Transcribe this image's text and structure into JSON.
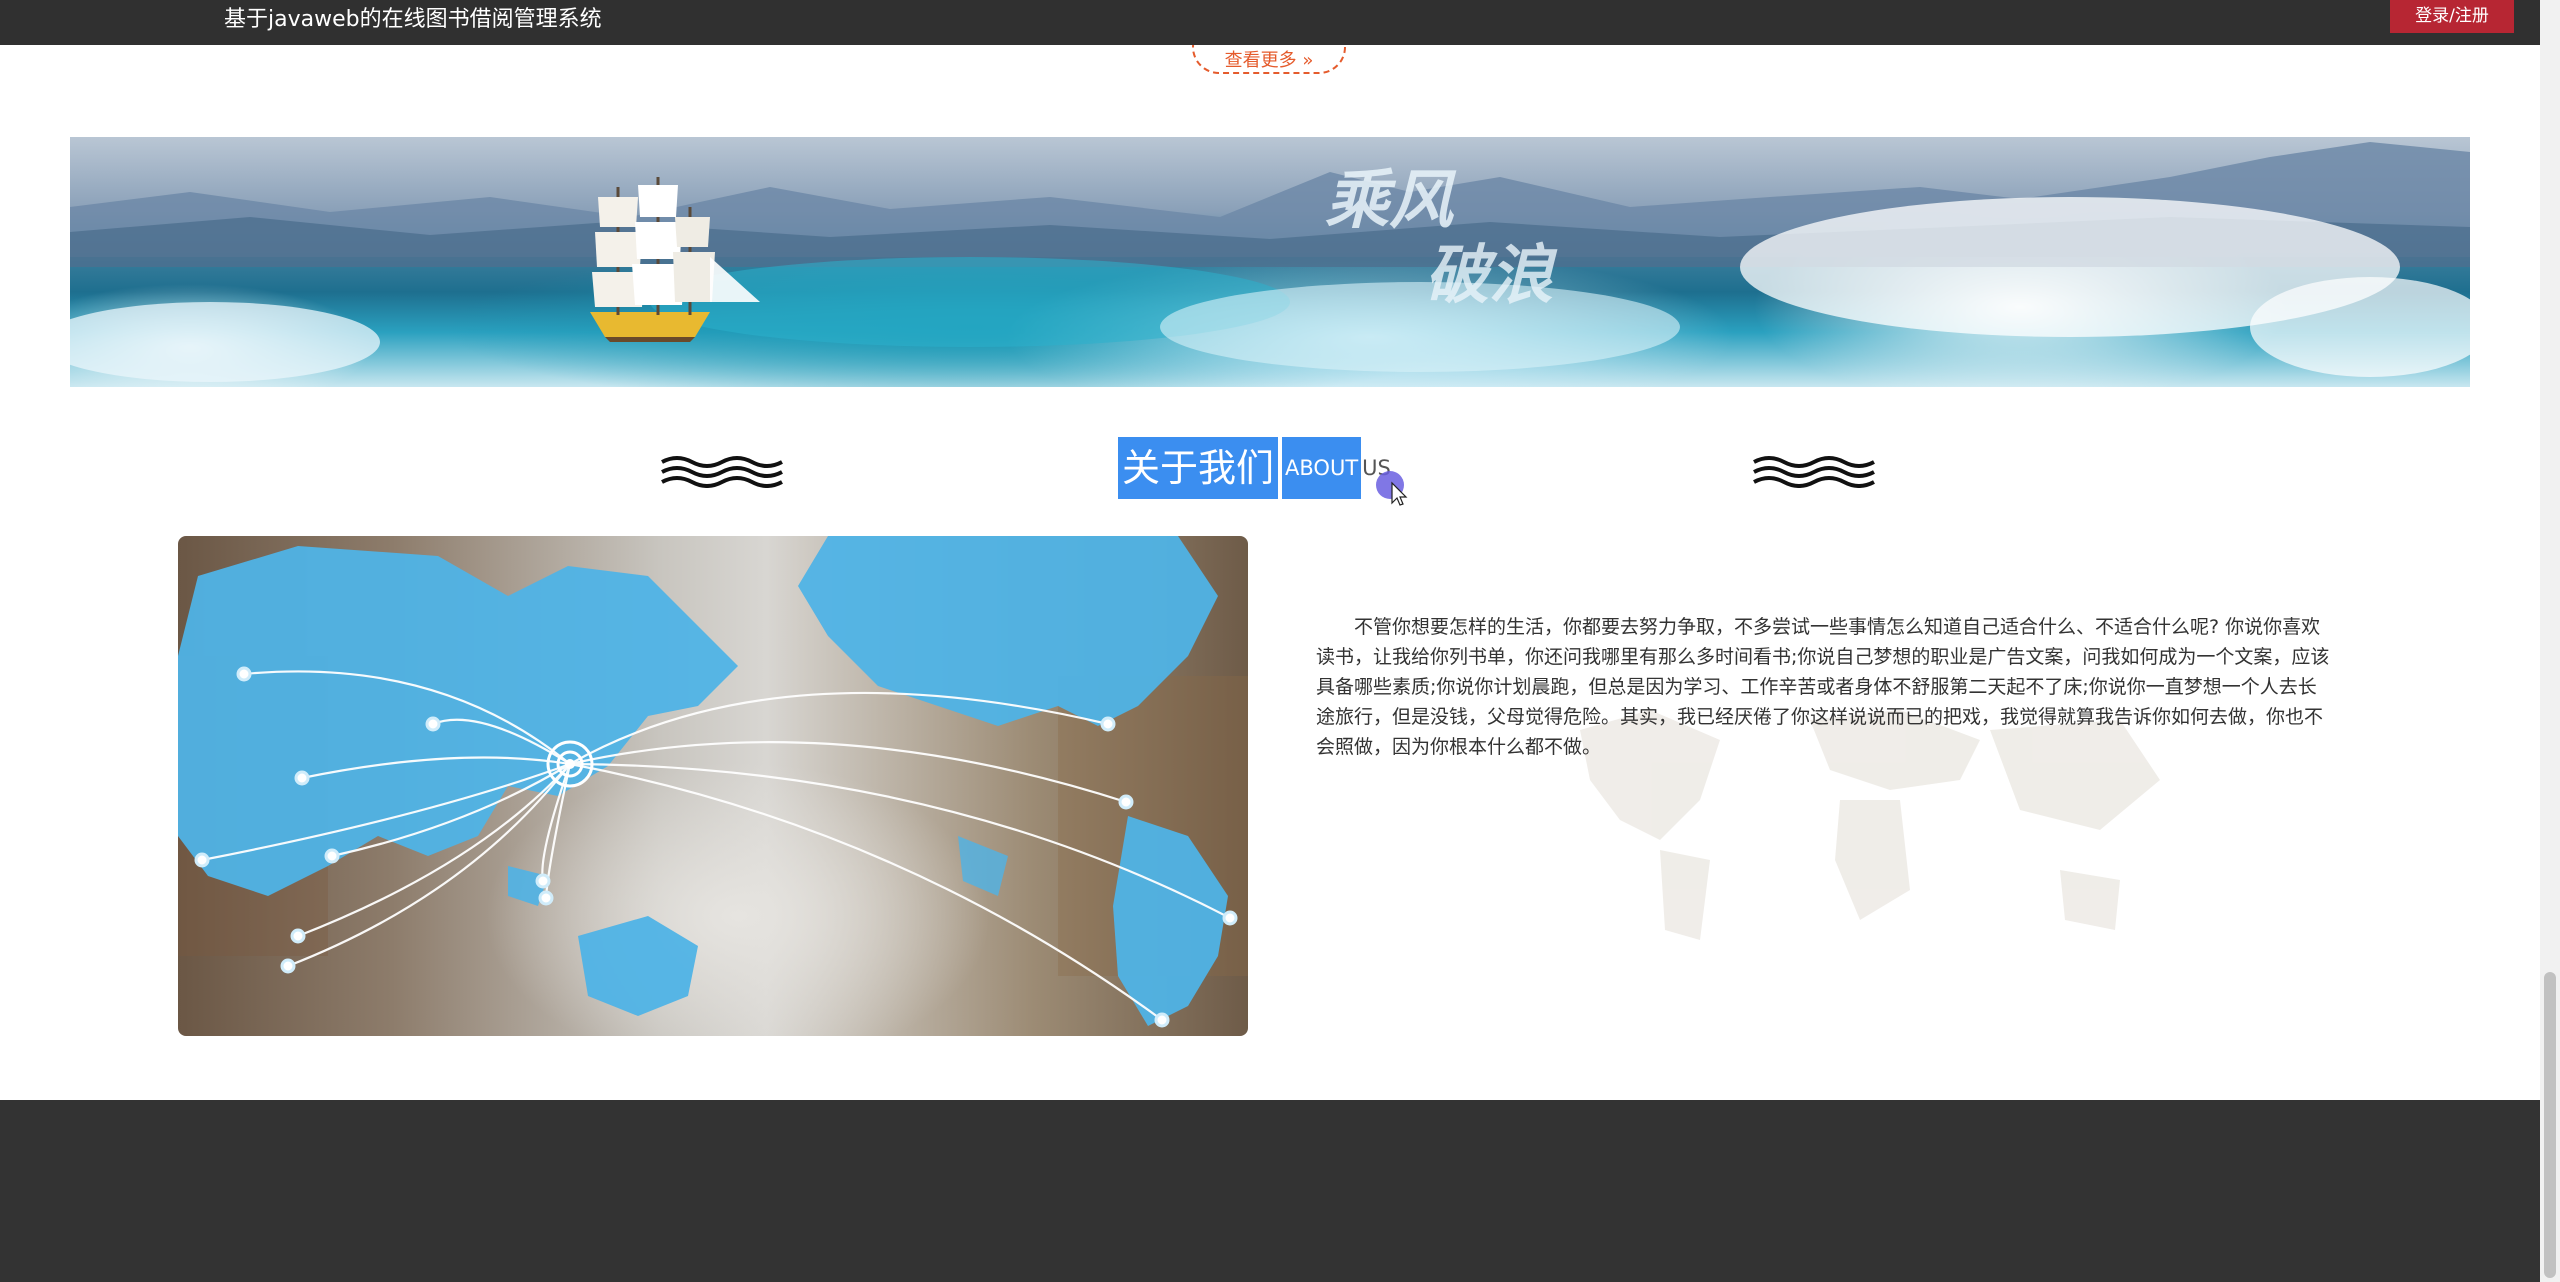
{
  "header": {
    "site_title": "基于javaweb的在线图书借阅管理系统",
    "login_label": "登录/注册"
  },
  "more_button": {
    "label": "查看更多 »"
  },
  "banner": {
    "caption_line1": "乘风",
    "caption_line2": "破浪"
  },
  "about": {
    "title_cn": "关于我们",
    "title_en_1": "ABOUT",
    "title_en_2": "US",
    "paragraph": "不管你想要怎样的生活，你都要去努力争取，不多尝试一些事情怎么知道自己适合什么、不适合什么呢? 你说你喜欢读书，让我给你列书单，你还问我哪里有那么多时间看书;你说自己梦想的职业是广告文案，问我如何成为一个文案，应该具备哪些素质;你说你计划晨跑，但总是因为学习、工作辛苦或者身体不舒服第二天起不了床;你说你一直梦想一个人去长途旅行，但是没钱，父母觉得危险。其实，我已经厌倦了你这样说说而已的把戏，我觉得就算我告诉你如何去做，你也不会照做，因为你根本什么都不做。"
  },
  "colors": {
    "topbar": "#303030",
    "login_button": "#b72633",
    "more_button_accent": "#e55b2c",
    "heading_highlight": "#3b8ef0",
    "footer": "#333333"
  }
}
